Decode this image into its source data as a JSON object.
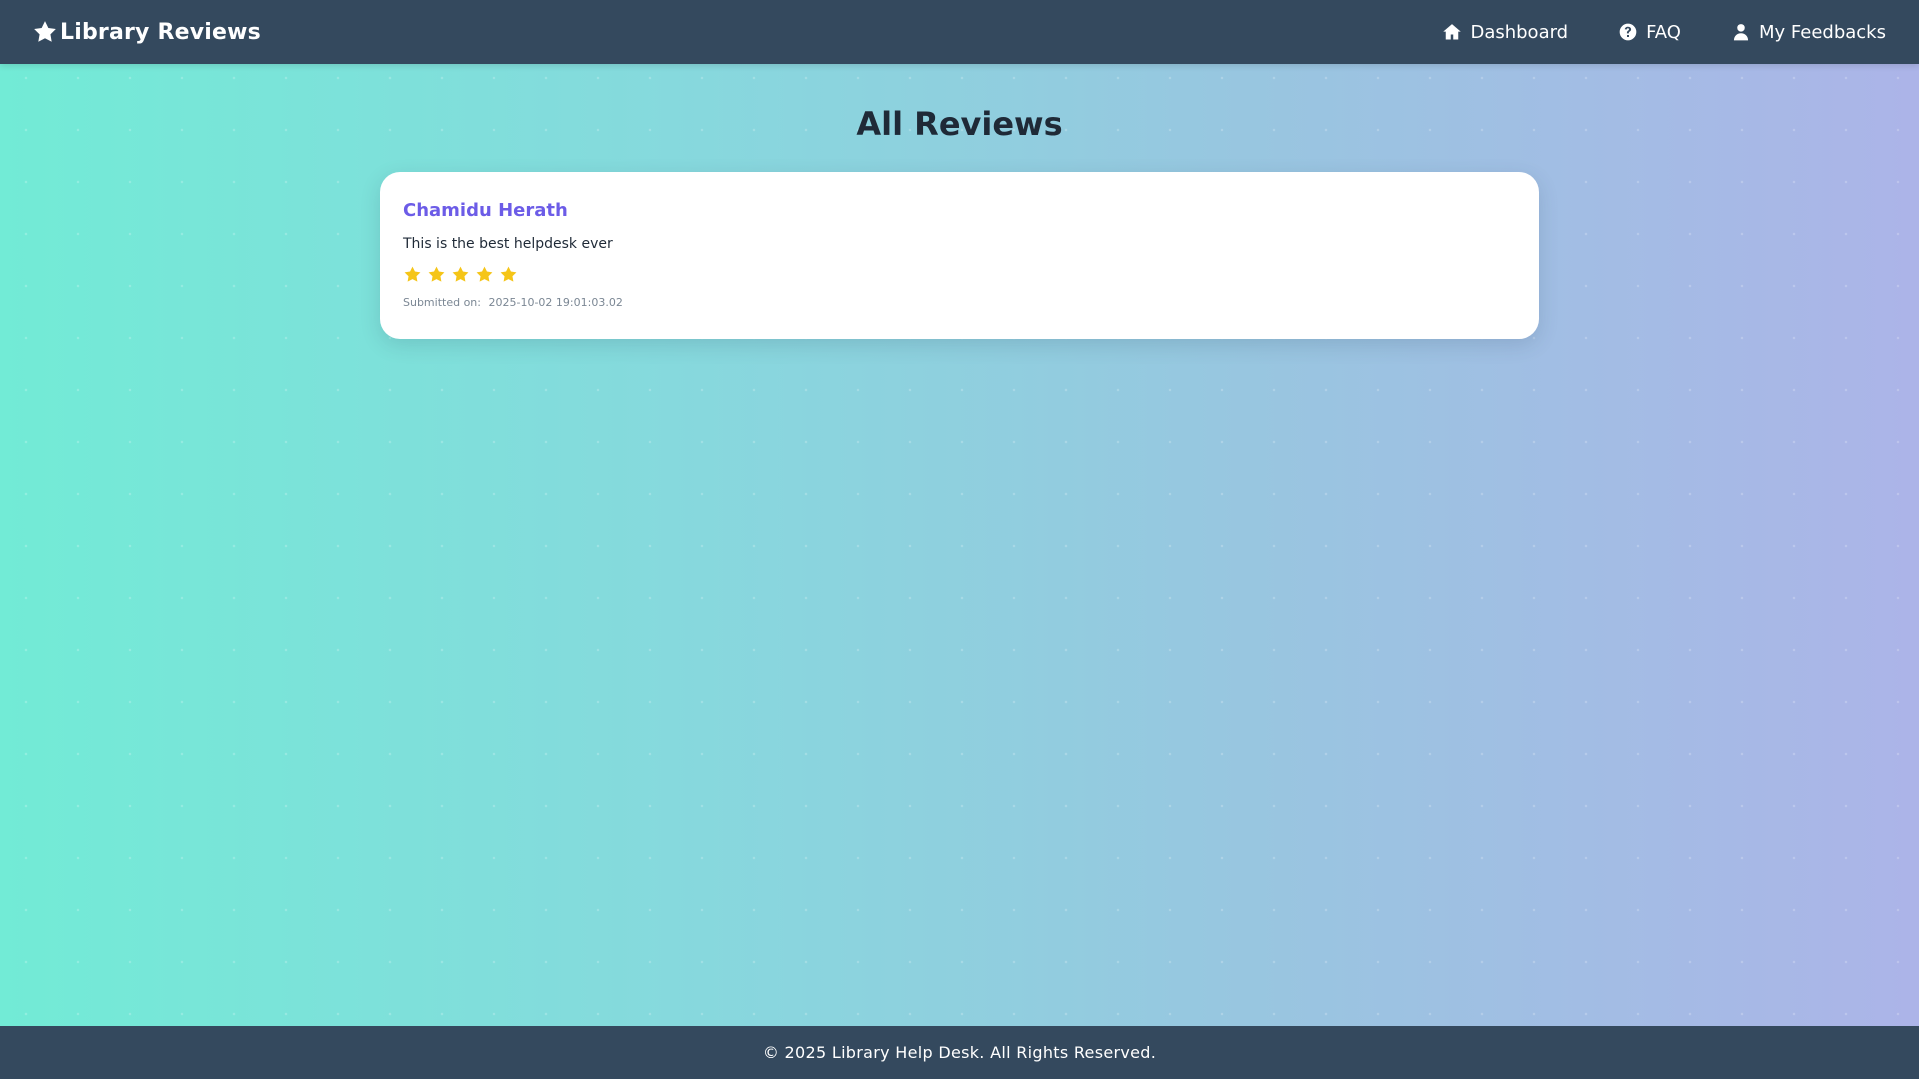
{
  "header": {
    "brand": "Library Reviews",
    "brand_icon": "star-icon",
    "nav": [
      {
        "label": "Dashboard",
        "icon": "home-icon"
      },
      {
        "label": "FAQ",
        "icon": "question-circle-icon"
      },
      {
        "label": "My Feedbacks",
        "icon": "user-icon"
      }
    ]
  },
  "main": {
    "title": "All Reviews",
    "reviews": [
      {
        "name": "Chamidu Herath",
        "comment": "This is the best helpdesk ever",
        "rating": 5,
        "submitted_label": "Submitted on:",
        "submitted_at": "2025-10-02 19:01:03.02"
      }
    ]
  },
  "footer": {
    "text": "© 2025 Library Help Desk. All Rights Reserved."
  },
  "colors": {
    "navbar": "#34495e",
    "reviewer_name": "#6c5ce7",
    "star": "#f5c518"
  }
}
